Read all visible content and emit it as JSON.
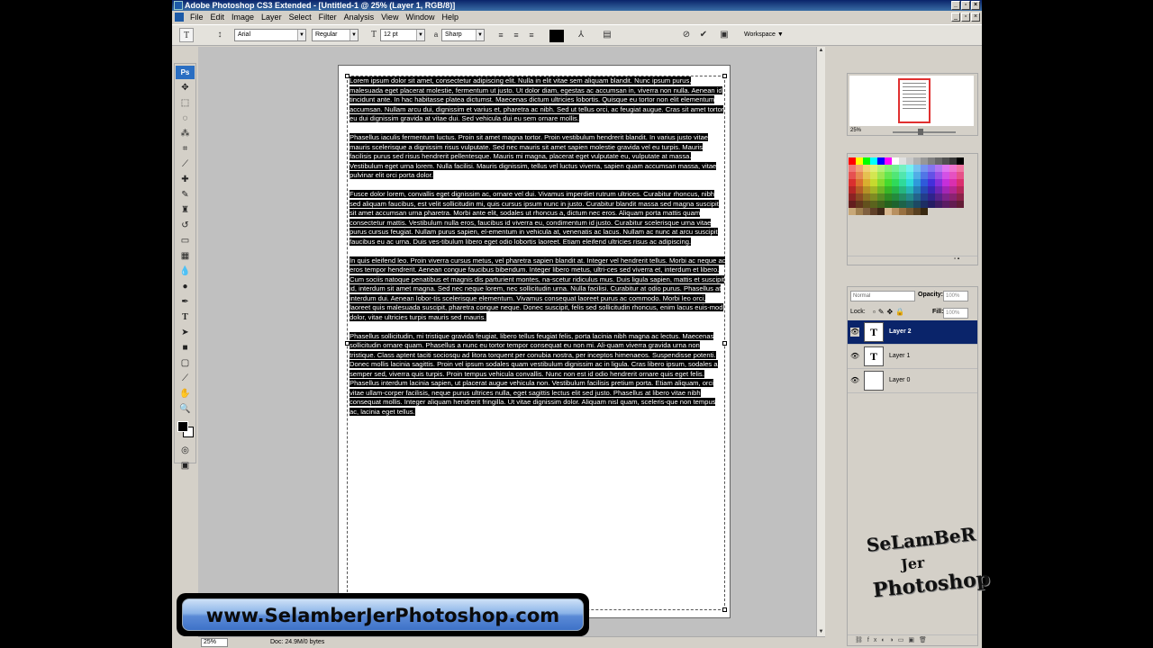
{
  "window": {
    "title": "Adobe Photoshop CS3 Extended - [Untitled-1 @ 25% (Layer 1, RGB/8)]",
    "app_icon": "Ps"
  },
  "menu": [
    "File",
    "Edit",
    "Image",
    "Layer",
    "Select",
    "Filter",
    "Analysis",
    "View",
    "Window",
    "Help"
  ],
  "options": {
    "font_family": "Arial",
    "font_style": "Regular",
    "font_size": "12 pt",
    "aa_prefix": "a",
    "antialias": "Sharp",
    "workspace": "Workspace"
  },
  "tools_logo": "Ps",
  "document": {
    "paragraphs": [
      "Lorem ipsum dolor sit amet, consectetur adipiscing elit. Nulla in elit vitae sem aliquam blandit. Nunc ipsum purus, malesuada eget placerat molestie, fermentum ut justo. Ut dolor diam, egestas ac accumsan in, viverra non nulla. Aenean id tincidunt ante. In hac habitasse platea dictumst. Maecenas dictum ultricies lobortis. Quisque eu tortor non elit elementum accumsan. Nullam arcu dui, dignissim et varius et, pharetra ac nibh. Sed ut tellus orci, ac feugiat augue. Cras sit amet tortor eu dui dignissim gravida at vitae dui. Sed vehicula dui eu sem ornare mollis.",
      "Phasellus iaculis fermentum luctus. Proin sit amet magna tortor. Proin vestibulum hendrerit blandit. In varius justo vitae mauris scelerisque a dignissim risus vulputate. Sed nec mauris sit amet sapien molestie gravida vel eu turpis. Mauris facilisis purus sed risus hendrerit pellentesque. Mauris mi magna, placerat eget vulputate eu, vulputate at massa. Vestibulum eget urna lorem. Nulla facilisi. Mauris dignissim, tellus vel luctus viverra, sapien quam accumsan massa, vitae pulvinar elit orci porta dolor.",
      "Fusce dolor lorem, convallis eget dignissim ac, ornare vel dui. Vivamus imperdiet rutrum ultrices. Curabitur rhoncus, nibh sed aliquam faucibus, est velit sollicitudin mi, quis cursus ipsum nunc in justo. Curabitur blandit massa sed magna suscipit sit amet accumsan urna pharetra. Morbi ante elit, sodales ut rhoncus a, dictum nec eros. Aliquam porta mattis quam consectetur mattis. Vestibulum nulla eros, faucibus id viverra eu, condimentum id justo. Curabitur scelerisque urna vitae purus cursus feugiat. Nullam purus sapien, el-ementum in vehicula at, venenatis ac lacus. Nullam ac nunc at arcu suscipit faucibus eu ac urna. Duis ves-tibulum libero eget odio lobortis laoreet. Etiam eleifend ultricies risus ac adipiscing.",
      "In quis eleifend leo. Proin viverra cursus metus, vel pharetra sapien blandit at. Integer vel hendrerit tellus. Morbi ac neque ac eros tempor hendrerit. Aenean congue faucibus bibendum. Integer libero metus, ultri-ces sed viverra et, interdum et libero. Cum sociis natoque penatibus et magnis dis parturient montes, na-scetur ridiculus mus. Duis ligula sapien, mattis et suscipit id, interdum sit amet magna. Sed nec neque lorem, nec sollicitudin urna. Nulla facilisi. Curabitur at odio purus. Phasellus at interdum dui. Aenean lobor-tis scelerisque elementum. Vivamus consequat laoreet purus ac commodo. Morbi leo orci, laoreet quis malesuada suscipit, pharetra congue neque. Donec suscipit, felis sed sollicitudin rhoncus, enim lacus euis-mod dolor, vitae ultricies turpis mauris sed mauris.",
      "Phasellus sollicitudin, mi tristique gravida feugiat, libero tellus feugiat felis, porta lacinia nibh magna ac lectus. Maecenas sollicitudin ornare quam. Phasellus a nunc eu tortor tempor consequat eu non mi. Ali-quam viverra gravida urna non tristique. Class aptent taciti sociosqu ad litora torquent per conubia nostra, per inceptos himenaeos. Suspendisse potenti. Donec mollis lacinia sagittis. Proin vel ipsum sodales quam vestibulum dignissim ac in ligula. Cras libero ipsum, sodales a semper sed, viverra quis turpis. Proin tempus vehicula convallis. Nunc non est id odio hendrerit ornare quis eget felis. Phasellus interdum lacinia sapien, ut placerat augue vehicula non. Vestibulum facilisis pretium porta. Etiam aliquam, orci vitae ullam-corper facilisis, neque purus ultrices nulla, eget sagittis lectus elit sed justo. Phasellus at libero vitae nibh consequat mollis. Integer aliquam hendrerit fringilla. Ut vitae dignissim dolor. Aliquam nisl quam, sceleris-que non tempus ac, lacinia eget tellus."
    ]
  },
  "status": {
    "zoom": "25%",
    "doc": "Doc: 24.9M/0 bytes"
  },
  "navigator": {
    "zoom": "25%"
  },
  "layers_panel": {
    "blend_mode": "Normal",
    "opacity_label": "Opacity:",
    "opacity": "100%",
    "lock_label": "Lock:",
    "fill_label": "Fill:",
    "fill": "100%",
    "layers": [
      {
        "name": "Layer 2",
        "thumb": "T",
        "selected": true
      },
      {
        "name": "Layer 1",
        "thumb": "T",
        "selected": false
      },
      {
        "name": "Layer 0",
        "thumb": "",
        "selected": false
      }
    ]
  },
  "watermark": {
    "line1": "SeLamBeR",
    "line2": "Jer",
    "line3": "Photoshop"
  },
  "banner": {
    "url": "www.SelamberJerPhotoshop.com"
  },
  "colors": {
    "title_bar": "#0a246a",
    "selection_bg": "#000000",
    "selected_layer": "#0a246a",
    "banner_blue": "#5a8ad6"
  }
}
